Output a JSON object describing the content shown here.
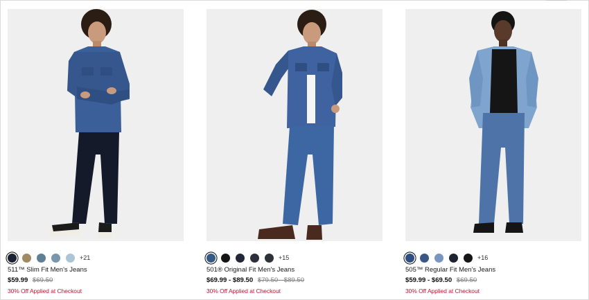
{
  "products": [
    {
      "name": "511™ Slim Fit Men's Jeans",
      "price": "$59.99",
      "original_price": "$69.50",
      "promo": "30% Off Applied at Checkout",
      "more_colors": "+21",
      "swatches": [
        "#1c2233",
        "#a08a63",
        "#5f7f95",
        "#7896ad",
        "#aac5d4"
      ],
      "selected_swatch": 0
    },
    {
      "name": "501® Original Fit Men's Jeans",
      "price": "$69.99 - $89.50",
      "original_price": "$79.50 - $89.50",
      "promo": "30% Off Applied at Checkout",
      "more_colors": "+15",
      "swatches": [
        "#345b86",
        "#151515",
        "#232838",
        "#2b2f3c",
        "#2e3138"
      ],
      "selected_swatch": 0
    },
    {
      "name": "505™ Regular Fit Men's Jeans",
      "price": "$59.99 - $69.50",
      "original_price": "$69.50",
      "promo": "30% Off Applied at Checkout",
      "more_colors": "+16",
      "swatches": [
        "#2f4f82",
        "#3a5784",
        "#7896bf",
        "#1d2230",
        "#151515"
      ],
      "selected_swatch": 0
    }
  ]
}
